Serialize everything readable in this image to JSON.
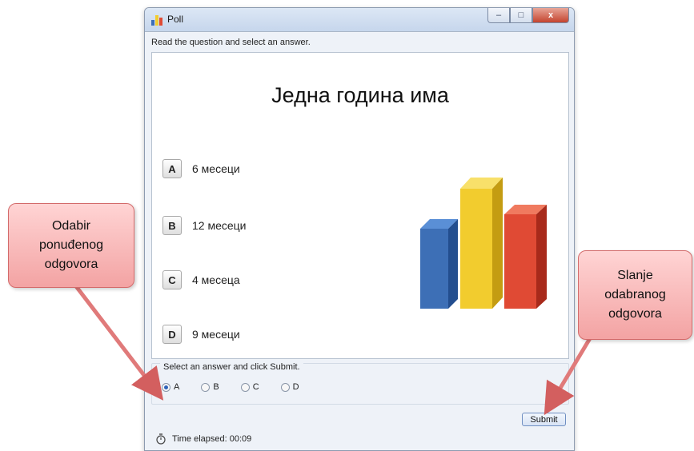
{
  "window": {
    "title": "Poll",
    "minimize_icon": "minimize-icon",
    "maximize_icon": "maximize-icon",
    "close_label": "x"
  },
  "instruction": "Read the question and select an answer.",
  "slide": {
    "question": "Једна година има",
    "options": [
      {
        "key": "A",
        "text": "6 месеци"
      },
      {
        "key": "B",
        "text": "12 месеци"
      },
      {
        "key": "C",
        "text": "4 месеца"
      },
      {
        "key": "D",
        "text": "9 месеци"
      }
    ],
    "chart_colors": {
      "blue": "#3d6fb6",
      "yellow": "#f2cc2e",
      "red": "#e04a34"
    }
  },
  "answer": {
    "label": "Select an answer and click Submit.",
    "choices": [
      "A",
      "B",
      "C",
      "D"
    ],
    "selected": "A"
  },
  "submit_label": "Submit",
  "timer_text": "Time elapsed: 00:09",
  "callouts": {
    "left": "Odabir\nponuđenog\nodgovora",
    "right": "Slanje\nodabranog\nodgovora"
  }
}
